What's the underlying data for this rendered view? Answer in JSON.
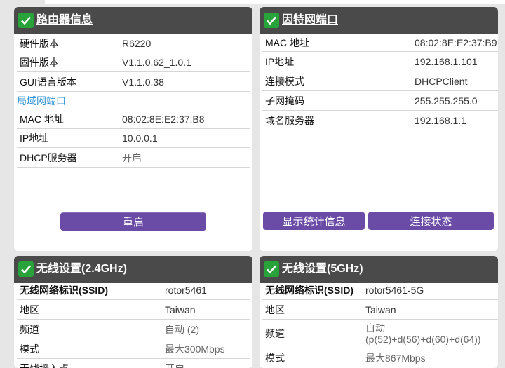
{
  "colors": {
    "header_bg": "#4a4a4a",
    "check_green": "#27a33a",
    "button_purple": "#6a4ba6",
    "section_blue": "#2a8fd4"
  },
  "router_info": {
    "title": "路由器信息",
    "rows": [
      {
        "key": "硬件版本",
        "value": "R6220"
      },
      {
        "key": "固件版本",
        "value": "V1.1.0.62_1.0.1"
      },
      {
        "key": "GUI语言版本",
        "value": "V1.1.0.38"
      }
    ],
    "lan_section": "局域网端口",
    "lan_rows": [
      {
        "key": "MAC 地址",
        "value": "08:02:8E:E2:37:B8"
      },
      {
        "key": "IP地址",
        "value": "10.0.0.1"
      },
      {
        "key": "DHCP服务器",
        "value": "开启"
      }
    ],
    "reboot_label": "重启"
  },
  "internet_port": {
    "title": "因特网端口",
    "rows": [
      {
        "key": "MAC 地址",
        "value": "08:02:8E:E2:37:B9"
      },
      {
        "key": "IP地址",
        "value": "192.168.1.101"
      },
      {
        "key": "连接模式",
        "value": "DHCPClient"
      },
      {
        "key": "子网掩码",
        "value": "255.255.255.0"
      },
      {
        "key": "域名服务器",
        "value": "192.168.1.1"
      }
    ],
    "stats_label": "显示统计信息",
    "status_label": "连接状态"
  },
  "wireless_24": {
    "title": "无线设置(2.4GHz)",
    "rows": [
      {
        "key": "无线网络标识(SSID)",
        "value": "rotor5461"
      },
      {
        "key": "地区",
        "value": "Taiwan"
      },
      {
        "key": "频道",
        "value": "自动 (2)"
      },
      {
        "key": "模式",
        "value": "最大300Mbps"
      },
      {
        "key": "无线接入点",
        "value": "开启"
      }
    ]
  },
  "wireless_5": {
    "title": "无线设置(5GHz)",
    "rows": [
      {
        "key": "无线网络标识(SSID)",
        "value": "rotor5461-5G"
      },
      {
        "key": "地区",
        "value": "Taiwan"
      },
      {
        "key": "频道",
        "value": "自动 (p(52)+d(56)+d(60)+d(64))"
      },
      {
        "key": "模式",
        "value": "最大867Mbps"
      }
    ]
  }
}
